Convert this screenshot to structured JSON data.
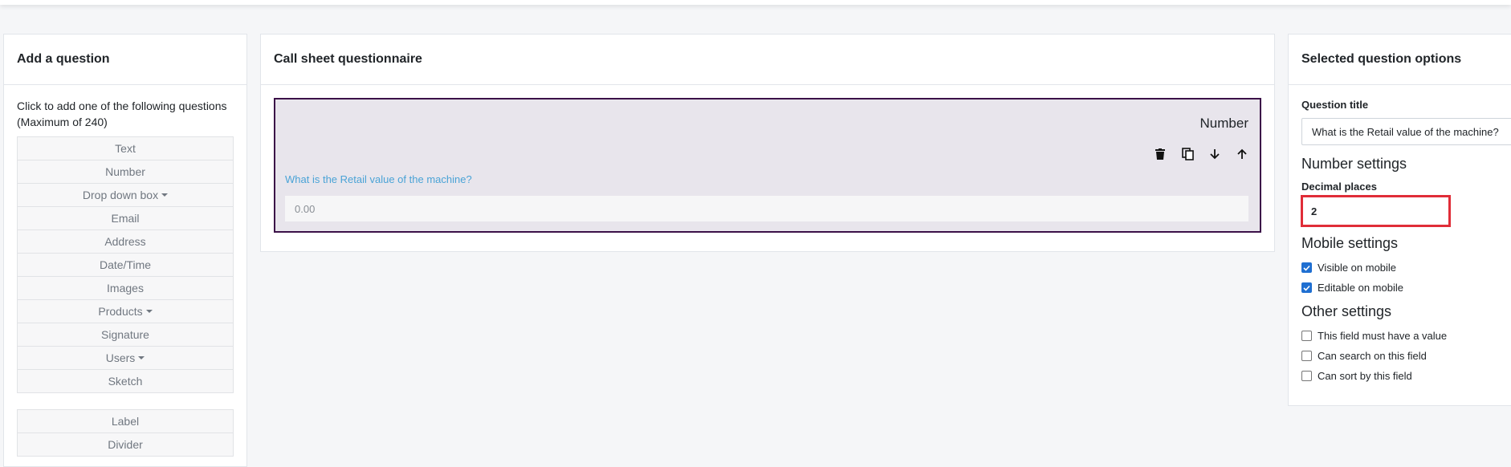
{
  "left_panel": {
    "title": "Add a question",
    "instructions": "Click to add one of the following questions (Maximum of 240)",
    "question_types": [
      {
        "label": "Text",
        "dropdown": false
      },
      {
        "label": "Number",
        "dropdown": false
      },
      {
        "label": "Drop down box",
        "dropdown": true
      },
      {
        "label": "Email",
        "dropdown": false
      },
      {
        "label": "Address",
        "dropdown": false
      },
      {
        "label": "Date/Time",
        "dropdown": false
      },
      {
        "label": "Images",
        "dropdown": false
      },
      {
        "label": "Products",
        "dropdown": true
      },
      {
        "label": "Signature",
        "dropdown": false
      },
      {
        "label": "Users",
        "dropdown": true
      },
      {
        "label": "Sketch",
        "dropdown": false
      }
    ],
    "layout_types": [
      {
        "label": "Label"
      },
      {
        "label": "Divider"
      }
    ]
  },
  "middle_panel": {
    "title": "Call sheet questionnaire",
    "question": {
      "type_label": "Number",
      "title": "What is the Retail value of the machine?",
      "placeholder": "0.00",
      "actions": [
        "trash-icon",
        "copy-icon",
        "arrow-down-icon",
        "arrow-up-icon"
      ]
    }
  },
  "right_panel": {
    "title": "Selected question options",
    "question_title_label": "Question title",
    "question_title_value": "What is the Retail value of the machine?",
    "number_settings_title": "Number settings",
    "decimal_places_label": "Decimal places",
    "decimal_places_value": "2",
    "mobile_settings_title": "Mobile settings",
    "mobile_settings": [
      {
        "label": "Visible on mobile",
        "checked": true
      },
      {
        "label": "Editable on mobile",
        "checked": true
      }
    ],
    "other_settings_title": "Other settings",
    "other_settings": [
      {
        "label": "This field must have a value",
        "checked": false
      },
      {
        "label": "Can search on this field",
        "checked": false
      },
      {
        "label": "Can sort by this field",
        "checked": false
      }
    ]
  },
  "colors": {
    "card_background": "#e8e5ec",
    "card_border": "#3b1148",
    "question_title": "#4aa3d6",
    "highlight_border": "#e02d38",
    "checkbox_checked": "#1f6fd1"
  }
}
